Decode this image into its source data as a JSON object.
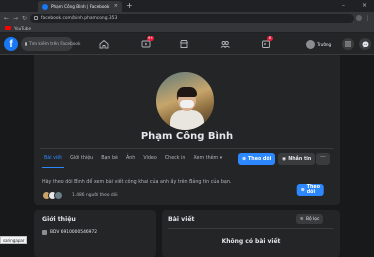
{
  "browser": {
    "tab_title": "Phạm Công Bình | Facebook",
    "tab_close": "×",
    "new_tab": "+",
    "url": "facebook.com/binh.phamcong.353",
    "bookmark": "YouTube",
    "win_min": "–",
    "win_close": "×"
  },
  "fbnav": {
    "logo": "f",
    "search_placeholder": "Tìm kiếm trên Facebook",
    "badges": {
      "watch": "9+",
      "gaming": "8"
    },
    "user_name": "Trường"
  },
  "profile": {
    "name": "Phạm Công Bình",
    "tabs": [
      "Bài viết",
      "Giới thiệu",
      "Bạn bè",
      "Ảnh",
      "Video",
      "Check in",
      "Xem thêm ▾"
    ],
    "follow_label": "Theo dõi",
    "message_label": "Nhắn tin",
    "more_label": "···"
  },
  "follow_card": {
    "text": "Hãy theo dõi Bình để xem bài viết công khai của anh ấy trên Bảng tin của bạn.",
    "count": "1.486 người theo dõi",
    "button": "Theo dõi"
  },
  "intro": {
    "title": "Giới thiệu",
    "item": "BDV 6910000546972"
  },
  "posts": {
    "title": "Bài viết",
    "filter": "Bộ lọc",
    "empty": "Không có bài viết"
  },
  "status_tip": "saringapar"
}
